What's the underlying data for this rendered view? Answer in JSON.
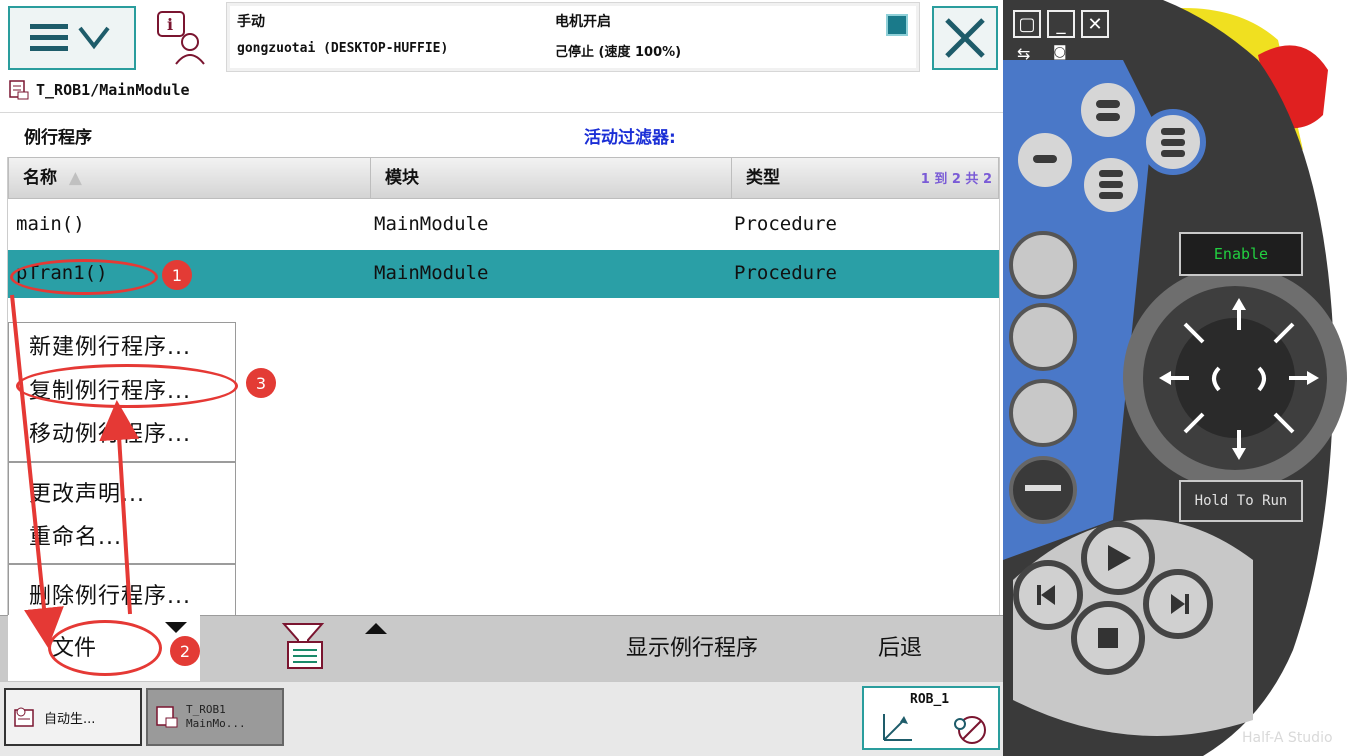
{
  "topbar": {
    "mode": "手动",
    "station": "gongzuotai (DESKTOP-HUFFIE)",
    "motor_status": "电机开启",
    "run_status": "己停止 (速度 100%)"
  },
  "path": "T_ROB1/MainModule",
  "list": {
    "title": "例行程序",
    "filter_label": "活动过滤器:",
    "columns": [
      "名称",
      "模块",
      "类型"
    ],
    "row_count": "1 到 2 共 2",
    "rows": [
      {
        "name": "main()",
        "module": "MainModule",
        "type": "Procedure",
        "selected": false
      },
      {
        "name": "pTran1()",
        "module": "MainModule",
        "type": "Procedure",
        "selected": true
      }
    ]
  },
  "file_menu": {
    "items": [
      "新建例行程序...",
      "复制例行程序...",
      "移动例行程序...",
      "更改声明...",
      "重命名...",
      "删除例行程序..."
    ]
  },
  "commands": {
    "file": "文件",
    "show_routine": "显示例行程序",
    "back": "后退"
  },
  "taskbar": {
    "task1": "自动生...",
    "task2_line1": "T_ROB1",
    "task2_line2": "MainMo...",
    "rob": "ROB_1"
  },
  "annotations": {
    "step1": "1",
    "step2": "2",
    "step3": "3",
    "color": "#e53935"
  },
  "device": {
    "enable": "Enable",
    "hold_to_run": "Hold To Run",
    "watermark": "Half-A Studio"
  },
  "colors": {
    "accent": "#2a9fa6",
    "filter_text": "#1b2fd6",
    "estop": "#e02020",
    "estop_ring": "#f0e020",
    "device_body": "#3a3a3a",
    "device_blue": "#4a78c8"
  }
}
